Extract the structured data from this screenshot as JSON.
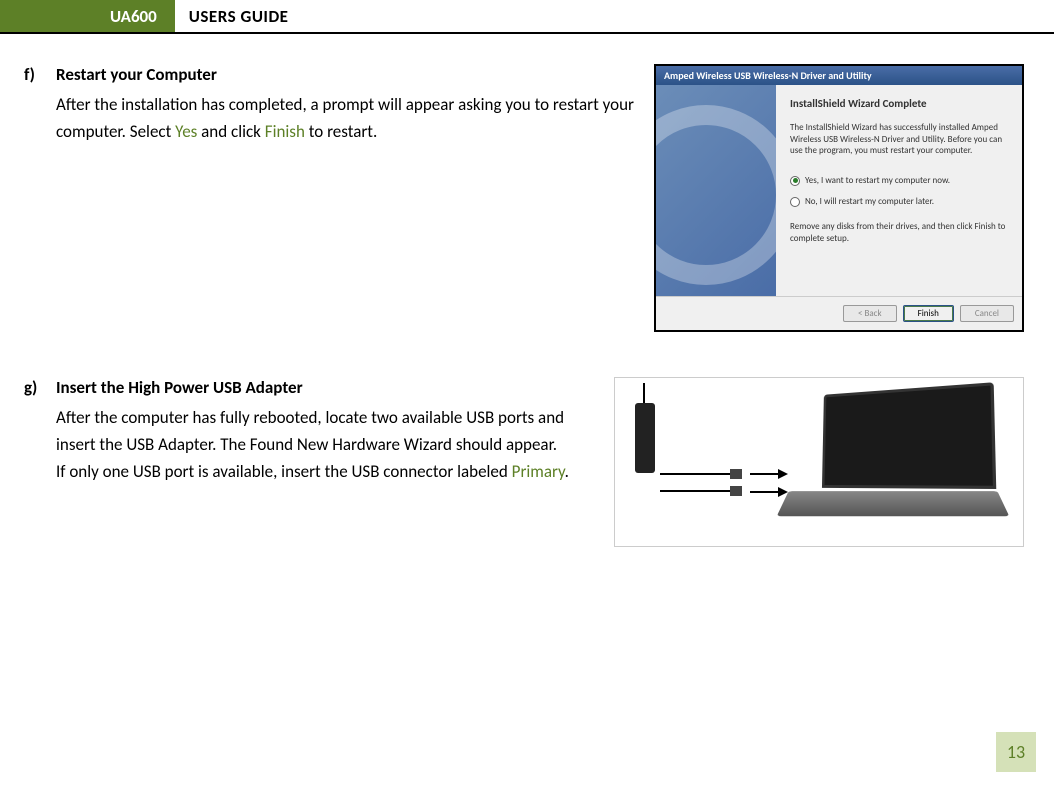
{
  "header": {
    "model": "UA600",
    "title": "USERS GUIDE"
  },
  "sections": [
    {
      "label": "f)",
      "title": "Restart your Computer",
      "body_pre": "After the installation has completed, a prompt will appear asking you to restart your computer.  Select ",
      "yes": "Yes",
      "body_mid": " and click ",
      "finish": "Finish",
      "body_post": " to restart."
    },
    {
      "label": "g)",
      "title": "Insert the High Power USB Adapter",
      "body_pre": "After the computer has fully rebooted, locate two available USB ports and insert the USB Adapter.  The Found New Hardware Wizard should appear.",
      "body_line2_pre": "If only one USB port is available, insert the USB connector labeled ",
      "primary": "Primary",
      "body_line2_post": "."
    }
  ],
  "installer": {
    "title": "Amped Wireless USB Wireless-N Driver and Utility",
    "heading": "InstallShield Wizard Complete",
    "desc": "The InstallShield Wizard has successfully installed Amped Wireless USB Wireless-N Driver and Utility.  Before you can use the program, you must restart your computer.",
    "radio_yes": "Yes, I want to restart my computer now.",
    "radio_no": "No, I will restart my computer later.",
    "note": "Remove any disks from their drives, and then click Finish to complete setup.",
    "btn_back": "< Back",
    "btn_finish": "Finish",
    "btn_cancel": "Cancel"
  },
  "page_number": "13"
}
